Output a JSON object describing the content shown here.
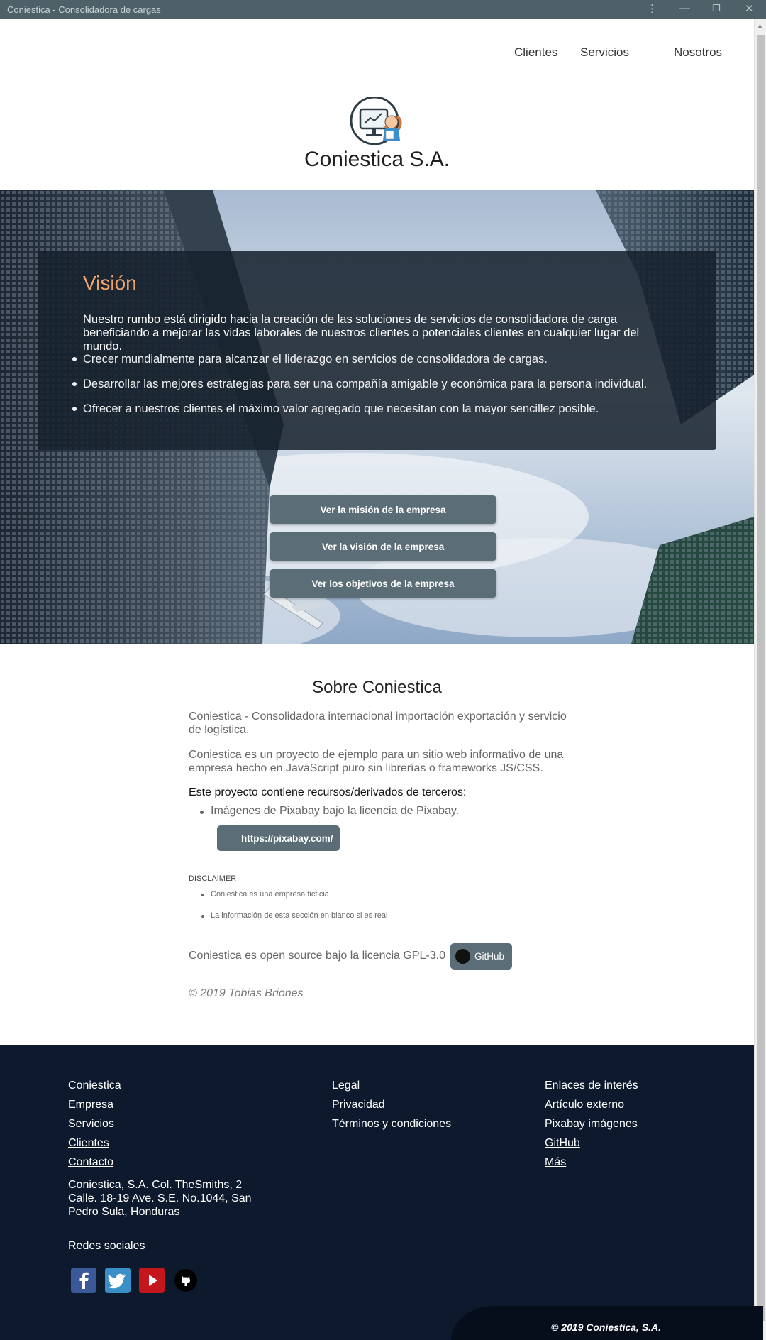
{
  "window": {
    "title": "Coniestica - Consolidadora de cargas"
  },
  "nav": {
    "items": [
      "Clientes",
      "Servicios",
      "Nosotros"
    ]
  },
  "brand": {
    "title": "Coniestica S.A."
  },
  "vision": {
    "title": "Visión",
    "intro": "Nuestro rumbo está dirigido hacia la creación de las soluciones de servicios de consolidadora de carga beneficiando a mejorar las vidas laborales de nuestros clientes o potenciales clientes en cualquier lugar del mundo.",
    "points": [
      "Crecer mundialmente para alcanzar el liderazgo en servicios de consolidadora de cargas.",
      "Desarrollar las mejores estrategias para ser una compañía amigable y económica para la persona individual.",
      "Ofrecer a nuestros clientes el máximo valor agregado que necesitan con la mayor sencillez posible."
    ]
  },
  "hero_buttons": [
    "Ver la misión de la empresa",
    "Ver la visión de la empresa",
    "Ver los objetivos de la empresa"
  ],
  "about": {
    "title": "Sobre Coniestica",
    "p1": "Coniestica - Consolidadora internacional importación exportación y servicio de logística.",
    "p2": "Coniestica es un proyecto de ejemplo para un sitio web informativo de una empresa hecho en JavaScript puro sin librerías o frameworks JS/CSS.",
    "third_party_heading": "Este proyecto contiene recursos/derivados de terceros:",
    "third_party_item": "Imágenes de Pixabay bajo la licencia de Pixabay.",
    "pixabay_button": "https://pixabay.com/",
    "disclaimer_heading": "DISCLAIMER",
    "disclaimer_items": [
      "Coniestica es una empresa ficticia",
      "La información de esta sección en blanco si es real"
    ],
    "license_text": "Coniestica es open source bajo la licencia GPL-3.0",
    "github_button": "GitHub",
    "copyright": "© 2019 Tobias Briones"
  },
  "footer": {
    "col1": {
      "heading": "Coniestica",
      "links": [
        "Empresa",
        "Servicios",
        "Clientes",
        "Contacto"
      ]
    },
    "address": "Coniestica, S.A. Col. TheSmiths, 2 Calle. 18-19 Ave. S.E. No.1044, San Pedro Sula, Honduras",
    "col2": {
      "heading": "Legal",
      "links": [
        "Privacidad",
        "Términos y condiciones"
      ]
    },
    "col3": {
      "heading": "Enlaces de interés",
      "links": [
        "Artículo externo",
        "Pixabay imágenes",
        "GitHub",
        "Más"
      ]
    },
    "social_heading": "Redes sociales",
    "social_icons": [
      "facebook-icon",
      "twitter-icon",
      "youtube-icon",
      "github-icon"
    ],
    "copyright": "© 2019 Coniestica, S.A."
  },
  "colors": {
    "accent": "#f0a36b",
    "button": "#5b6d76",
    "footer_bg": "#0d1a2e",
    "titlebar": "#4f6168"
  }
}
